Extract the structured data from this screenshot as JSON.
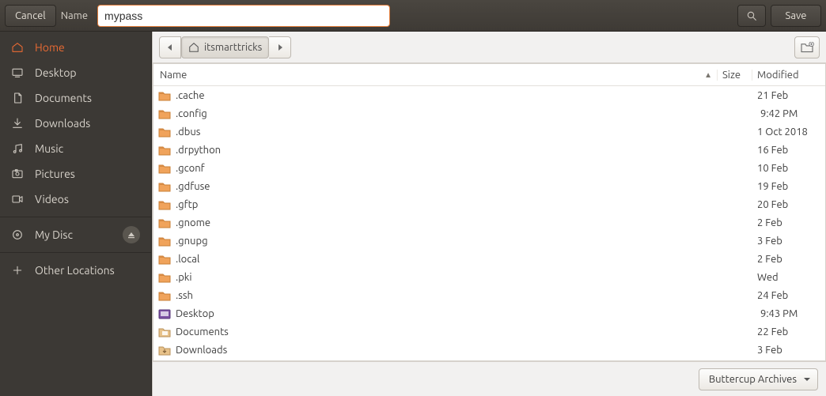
{
  "header": {
    "cancel": "Cancel",
    "name_label": "Name",
    "name_value": "mypass",
    "save": "Save"
  },
  "sidebar": {
    "items": [
      {
        "icon": "home",
        "label": "Home",
        "active": true
      },
      {
        "icon": "desktop",
        "label": "Desktop"
      },
      {
        "icon": "documents",
        "label": "Documents"
      },
      {
        "icon": "downloads",
        "label": "Downloads"
      },
      {
        "icon": "music",
        "label": "Music"
      },
      {
        "icon": "pictures",
        "label": "Pictures"
      },
      {
        "icon": "videos",
        "label": "Videos"
      },
      {
        "icon": "disc",
        "label": "My Disc",
        "eject": true
      },
      {
        "icon": "other",
        "label": "Other Locations"
      }
    ]
  },
  "pathbar": {
    "current": "itsmarttricks"
  },
  "columns": {
    "name": "Name",
    "size": "Size",
    "modified": "Modified"
  },
  "files": [
    {
      "icon": "folder",
      "name": ".cache",
      "size": "",
      "modified": "21 Feb"
    },
    {
      "icon": "folder",
      "name": ".config",
      "size": "",
      "modified": "9:42 PM",
      "indent": true
    },
    {
      "icon": "folder",
      "name": ".dbus",
      "size": "",
      "modified": "1 Oct 2018"
    },
    {
      "icon": "folder",
      "name": ".drpython",
      "size": "",
      "modified": "16 Feb"
    },
    {
      "icon": "folder",
      "name": ".gconf",
      "size": "",
      "modified": "10 Feb"
    },
    {
      "icon": "folder",
      "name": ".gdfuse",
      "size": "",
      "modified": "19 Feb"
    },
    {
      "icon": "folder",
      "name": ".gftp",
      "size": "",
      "modified": "20 Feb"
    },
    {
      "icon": "folder",
      "name": ".gnome",
      "size": "",
      "modified": "2 Feb"
    },
    {
      "icon": "folder",
      "name": ".gnupg",
      "size": "",
      "modified": "3 Feb"
    },
    {
      "icon": "folder",
      "name": ".local",
      "size": "",
      "modified": "2 Feb"
    },
    {
      "icon": "folder",
      "name": ".pki",
      "size": "",
      "modified": "Wed"
    },
    {
      "icon": "folder",
      "name": ".ssh",
      "size": "",
      "modified": "24 Feb"
    },
    {
      "icon": "desktop-folder",
      "name": "Desktop",
      "size": "",
      "modified": "9:43 PM",
      "indent": true
    },
    {
      "icon": "docs-folder",
      "name": "Documents",
      "size": "",
      "modified": "22 Feb"
    },
    {
      "icon": "dl-folder",
      "name": "Downloads",
      "size": "",
      "modified": "3 Feb"
    }
  ],
  "footer": {
    "filter": "Buttercup Archives"
  }
}
